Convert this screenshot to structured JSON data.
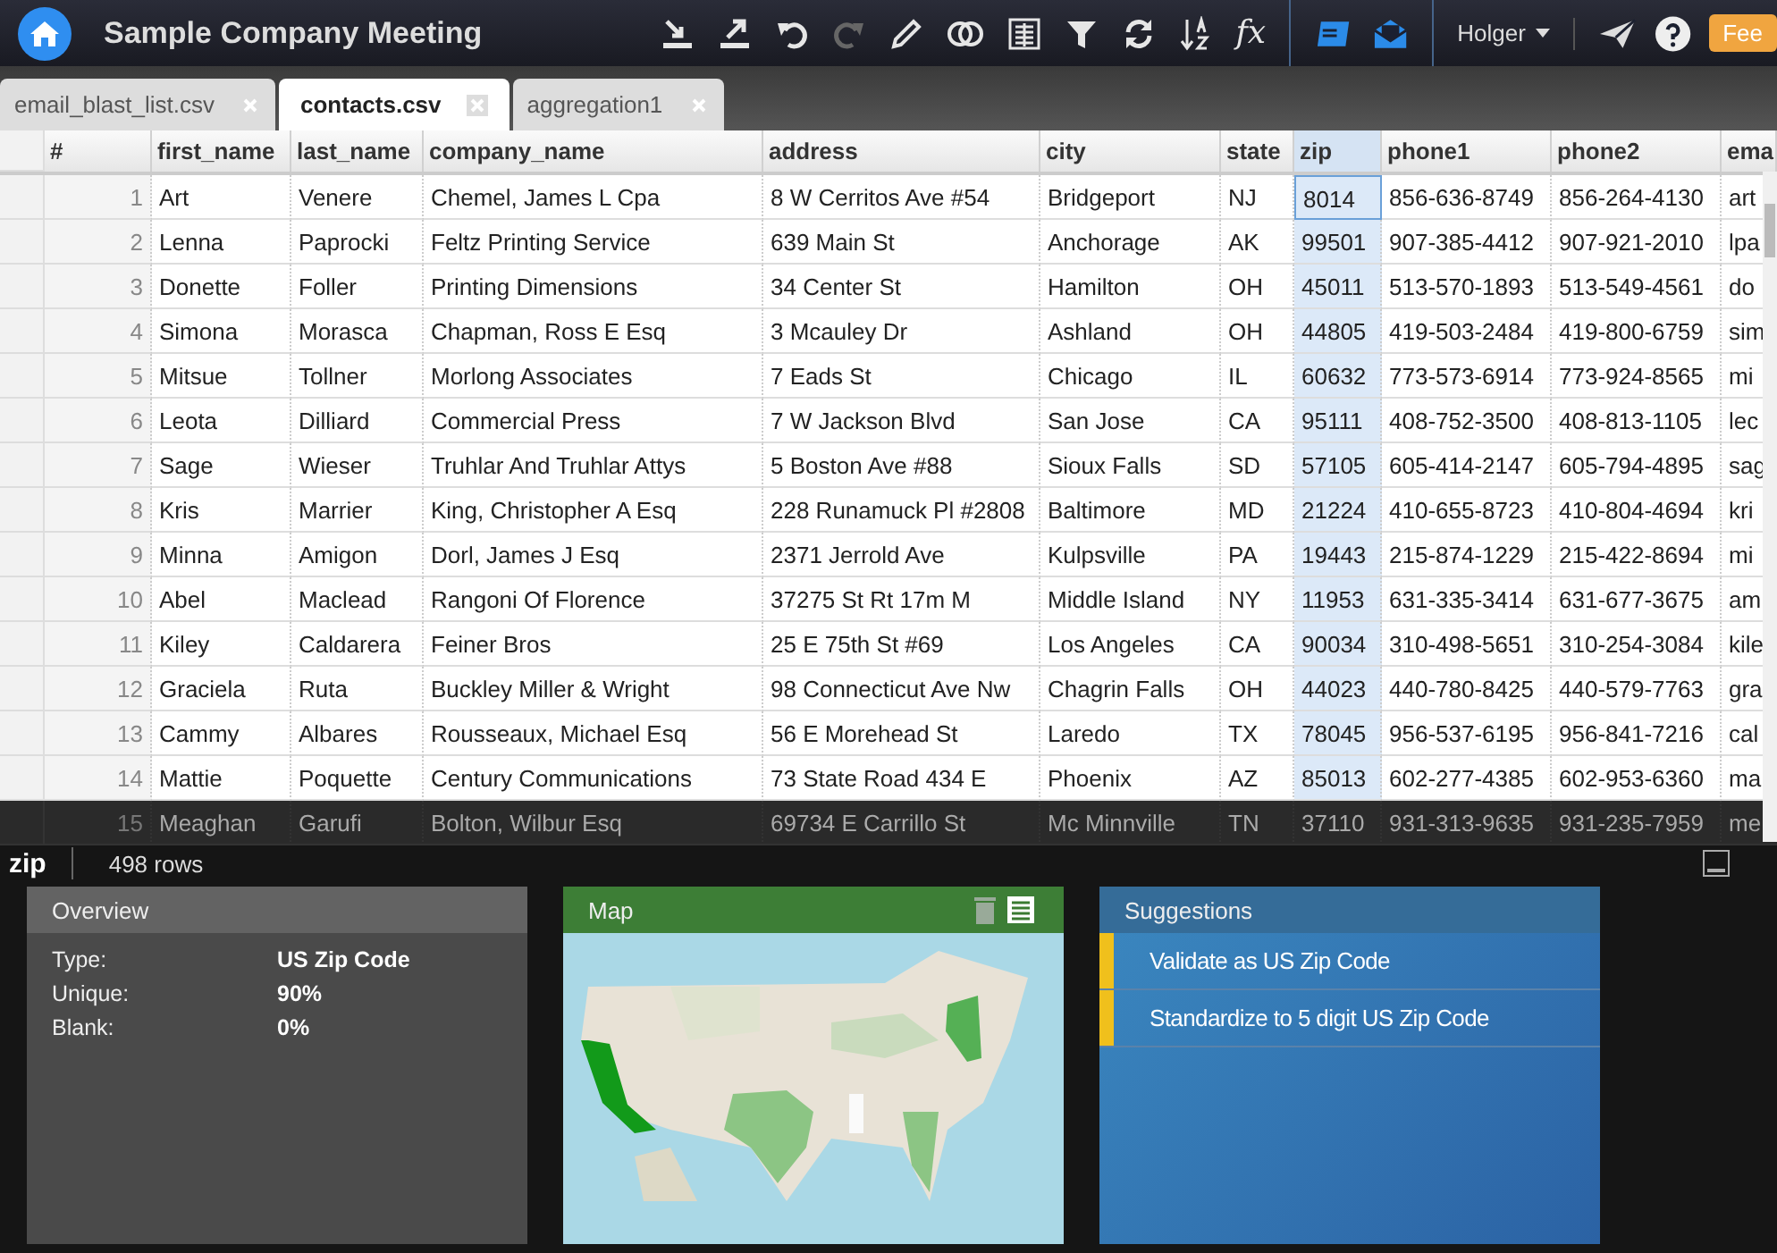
{
  "app": {
    "title": "Sample Company Meeting",
    "user": "Holger",
    "feedback": "Fee",
    "formula": "fx"
  },
  "toolbar": [
    {
      "kind": "import",
      "disabled": false
    },
    {
      "kind": "export",
      "disabled": false
    },
    {
      "kind": "undo",
      "disabled": false
    },
    {
      "kind": "redo",
      "disabled": true
    },
    {
      "kind": "edit",
      "disabled": false
    },
    {
      "kind": "join",
      "disabled": false
    },
    {
      "kind": "columns",
      "disabled": false
    },
    {
      "kind": "filter",
      "disabled": false
    },
    {
      "kind": "refresh",
      "disabled": false
    },
    {
      "kind": "sort",
      "disabled": false
    }
  ],
  "tabs": [
    {
      "label": "email_blast_list.csv",
      "selected": false
    },
    {
      "label": "contacts.csv",
      "selected": true
    },
    {
      "label": "aggregation1",
      "selected": false
    }
  ],
  "table": {
    "columns": [
      {
        "label": "#",
        "selected": false
      },
      {
        "label": "first_name",
        "selected": false
      },
      {
        "label": "last_name",
        "selected": false
      },
      {
        "label": "company_name",
        "selected": false
      },
      {
        "label": "address",
        "selected": false
      },
      {
        "label": "city",
        "selected": false
      },
      {
        "label": "state",
        "selected": false
      },
      {
        "label": "zip",
        "selected": true
      },
      {
        "label": "phone1",
        "selected": false
      },
      {
        "label": "phone2",
        "selected": false
      },
      {
        "label": "ema",
        "selected": false
      }
    ],
    "rows": [
      [
        "1",
        "Art",
        "Venere",
        "Chemel, James L Cpa",
        "8 W Cerritos Ave #54",
        "Bridgeport",
        "NJ",
        "8014",
        "856-636-8749",
        "856-264-4130",
        "art"
      ],
      [
        "2",
        "Lenna",
        "Paprocki",
        "Feltz Printing Service",
        "639 Main St",
        "Anchorage",
        "AK",
        "99501",
        "907-385-4412",
        "907-921-2010",
        "lpa"
      ],
      [
        "3",
        "Donette",
        "Foller",
        "Printing Dimensions",
        "34 Center St",
        "Hamilton",
        "OH",
        "45011",
        "513-570-1893",
        "513-549-4561",
        "do"
      ],
      [
        "4",
        "Simona",
        "Morasca",
        "Chapman, Ross E Esq",
        "3 Mcauley Dr",
        "Ashland",
        "OH",
        "44805",
        "419-503-2484",
        "419-800-6759",
        "sim"
      ],
      [
        "5",
        "Mitsue",
        "Tollner",
        "Morlong Associates",
        "7 Eads St",
        "Chicago",
        "IL",
        "60632",
        "773-573-6914",
        "773-924-8565",
        "mi"
      ],
      [
        "6",
        "Leota",
        "Dilliard",
        "Commercial Press",
        "7 W Jackson Blvd",
        "San Jose",
        "CA",
        "95111",
        "408-752-3500",
        "408-813-1105",
        "lec"
      ],
      [
        "7",
        "Sage",
        "Wieser",
        "Truhlar And Truhlar Attys",
        "5 Boston Ave #88",
        "Sioux Falls",
        "SD",
        "57105",
        "605-414-2147",
        "605-794-4895",
        "sag"
      ],
      [
        "8",
        "Kris",
        "Marrier",
        "King, Christopher A Esq",
        "228 Runamuck Pl #2808",
        "Baltimore",
        "MD",
        "21224",
        "410-655-8723",
        "410-804-4694",
        "kri"
      ],
      [
        "9",
        "Minna",
        "Amigon",
        "Dorl, James J Esq",
        "2371 Jerrold Ave",
        "Kulpsville",
        "PA",
        "19443",
        "215-874-1229",
        "215-422-8694",
        "mi"
      ],
      [
        "10",
        "Abel",
        "Maclead",
        "Rangoni Of Florence",
        "37275 St  Rt 17m M",
        "Middle Island",
        "NY",
        "11953",
        "631-335-3414",
        "631-677-3675",
        "am"
      ],
      [
        "11",
        "Kiley",
        "Caldarera",
        "Feiner Bros",
        "25 E 75th St #69",
        "Los Angeles",
        "CA",
        "90034",
        "310-498-5651",
        "310-254-3084",
        "kile"
      ],
      [
        "12",
        "Graciela",
        "Ruta",
        "Buckley Miller & Wright",
        "98 Connecticut Ave Nw",
        "Chagrin Falls",
        "OH",
        "44023",
        "440-780-8425",
        "440-579-7763",
        "gra"
      ],
      [
        "13",
        "Cammy",
        "Albares",
        "Rousseaux, Michael Esq",
        "56 E Morehead St",
        "Laredo",
        "TX",
        "78045",
        "956-537-6195",
        "956-841-7216",
        "cal"
      ],
      [
        "14",
        "Mattie",
        "Poquette",
        "Century Communications",
        "73 State Road 434 E",
        "Phoenix",
        "AZ",
        "85013",
        "602-277-4385",
        "602-953-6360",
        "ma"
      ]
    ]
  },
  "profile": {
    "field": "zip",
    "rows": "498 rows",
    "underlying_row": [
      "15",
      "Meaghan",
      "Garufi",
      "Bolton, Wilbur Esq",
      "69734 E Carrillo St",
      "Mc Minnville",
      "TN",
      "37110",
      "931-313-9635",
      "931-235-7959",
      "me"
    ],
    "overview": {
      "title": "Overview",
      "stats": [
        {
          "label": "Type:",
          "value": "US Zip Code"
        },
        {
          "label": "Unique:",
          "value": "90%"
        },
        {
          "label": "Blank:",
          "value": "0%"
        }
      ]
    },
    "map": {
      "title": "Map"
    },
    "suggestions": {
      "title": "Suggestions",
      "items": [
        "Validate as US Zip Code",
        "Standardize to 5 digit US Zip Code"
      ]
    }
  }
}
